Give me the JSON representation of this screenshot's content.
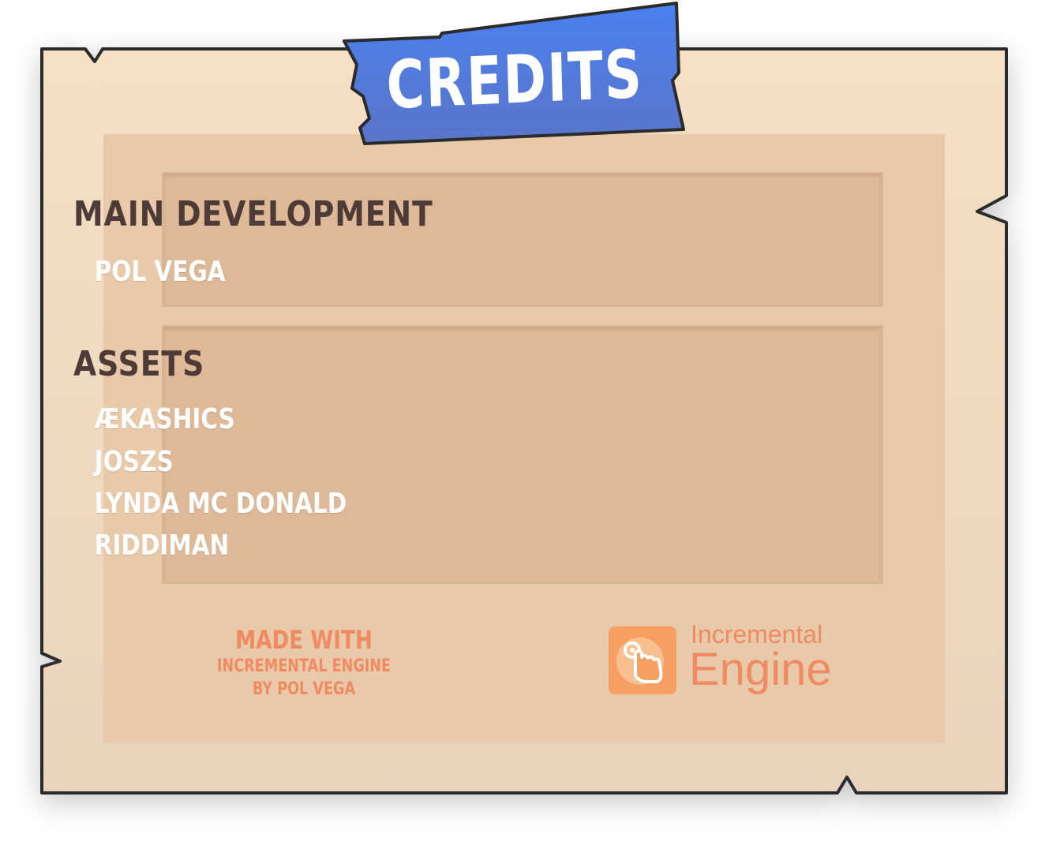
{
  "title": "CREDITS",
  "sections": [
    {
      "heading": "MAIN DEVELOPMENT",
      "names": [
        "POL VEGA"
      ]
    },
    {
      "heading": "ASSETS",
      "names": [
        "ÆKASHICS",
        "JOSZS",
        "LYNDA MC DONALD",
        "RIDDIMAN"
      ]
    }
  ],
  "footer": {
    "made_with": "MADE WITH",
    "engine_line": "INCREMENTAL ENGINE",
    "by_line": "BY POL VEGA"
  },
  "engine_logo": {
    "word1": "Incremental",
    "word2": "Engine",
    "icon": "tap-finger-icon"
  },
  "colors": {
    "panel_bg": "#f3dfc6",
    "panel_border": "#2b2b2b",
    "inner_bg": "#e8c9a9",
    "box_bg": "#ddb998",
    "heading_text": "#4e3a36",
    "name_text": "#ffffff",
    "title_banner": "#4a78e8",
    "accent_orange": "#f08a62"
  }
}
